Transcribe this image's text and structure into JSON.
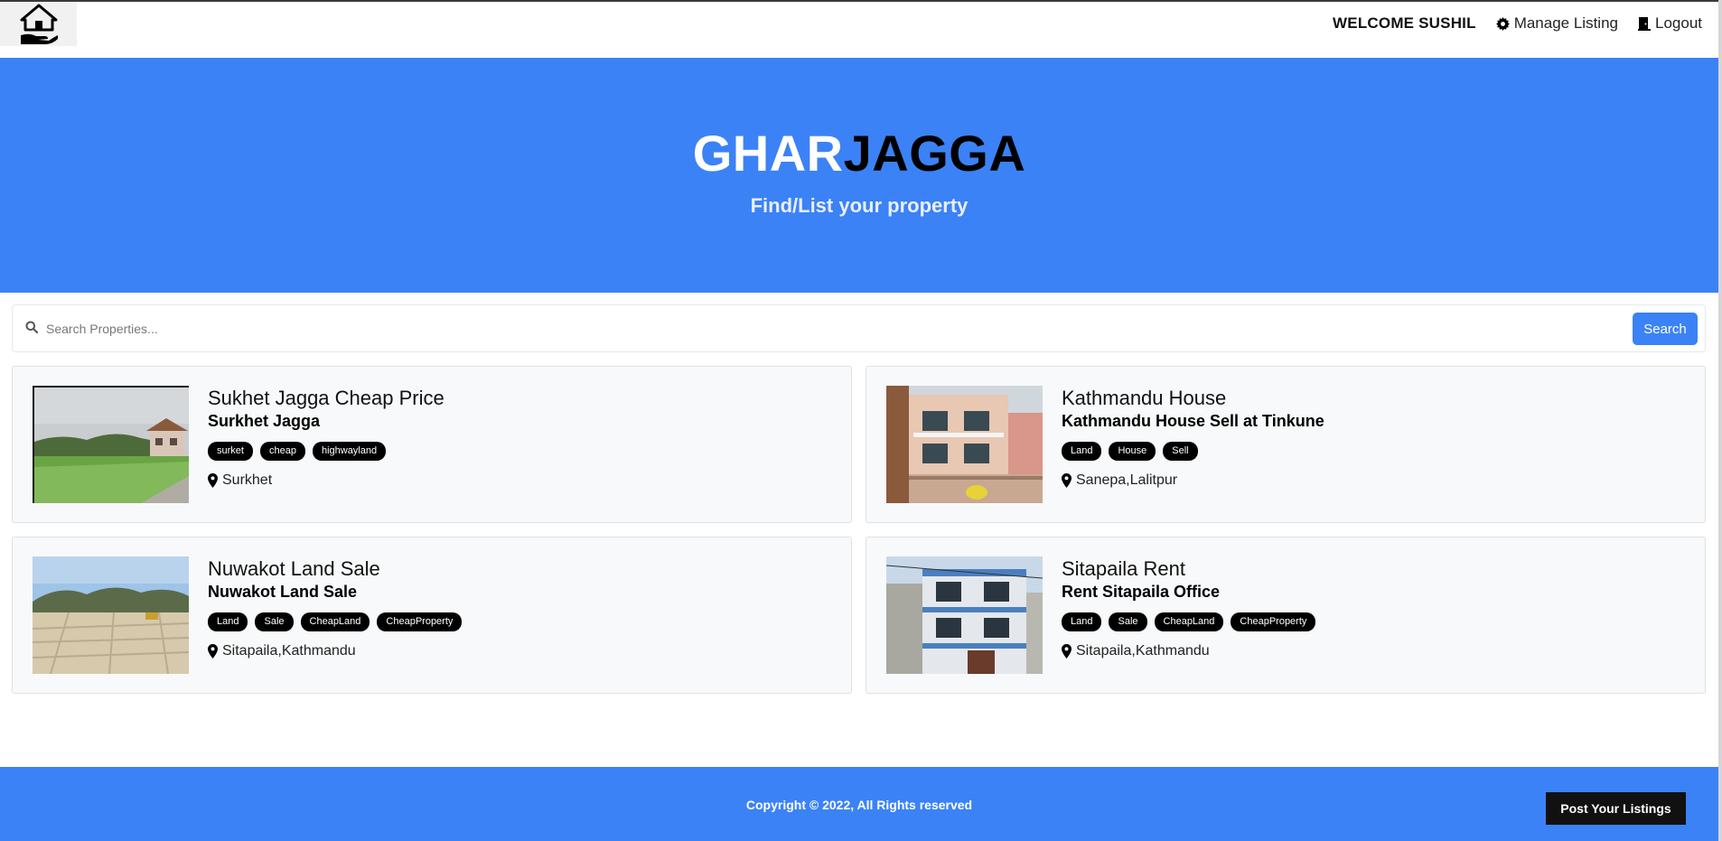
{
  "navbar": {
    "welcome": "WELCOME SUSHIL",
    "manage_listing": "Manage Listing",
    "logout": "Logout"
  },
  "hero": {
    "brand_part1": "GHAR",
    "brand_part2": "JAGGA",
    "tagline": "Find/List your property"
  },
  "search": {
    "placeholder": "Search Properties...",
    "button": "Search"
  },
  "listings": [
    {
      "title": "Sukhet Jagga Cheap Price",
      "subtitle": "Surkhet Jagga",
      "tags": [
        "surket",
        "cheap",
        "highwayland"
      ],
      "location": "Surkhet",
      "image": "paddy-field-photo"
    },
    {
      "title": "Kathmandu House",
      "subtitle": "Kathmandu House Sell at Tinkune",
      "tags": [
        "Land",
        "House",
        "Sell"
      ],
      "location": "Sanepa,Lalitpur",
      "image": "house-photo"
    },
    {
      "title": "Nuwakot Land Sale",
      "subtitle": "Nuwakot Land Sale",
      "tags": [
        "Land",
        "Sale",
        "CheapLand",
        "CheapProperty"
      ],
      "location": "Sitapaila,Kathmandu",
      "image": "land-plot-photo"
    },
    {
      "title": "Sitapaila Rent",
      "subtitle": "Rent Sitapaila Office",
      "tags": [
        "Land",
        "Sale",
        "CheapLand",
        "CheapProperty"
      ],
      "location": "Sitapaila,Kathmandu",
      "image": "office-building-photo"
    }
  ],
  "footer": {
    "copyright": "Copyright © 2022, All Rights reserved",
    "post_button": "Post Your Listings"
  },
  "colors": {
    "primary": "#3b82f6",
    "dark": "#111111",
    "card_bg": "#f8f9fa"
  }
}
